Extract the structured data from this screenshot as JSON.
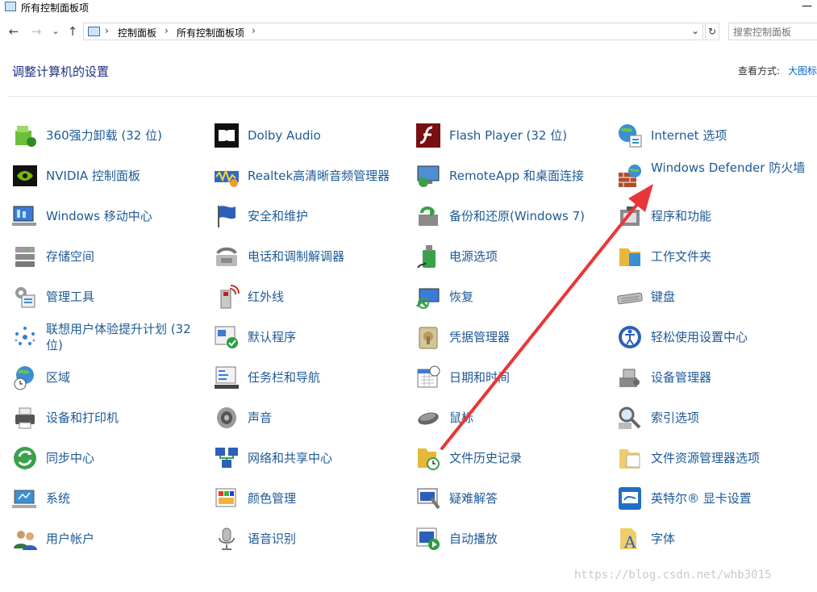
{
  "window": {
    "title": "所有控制面板项",
    "minimize_glyph": "—"
  },
  "nav": {
    "back_glyph": "←",
    "forward_glyph": "→",
    "recent_glyph": "⌄",
    "up_glyph": "↑"
  },
  "address": {
    "crumbs": [
      "控制面板",
      "所有控制面板项"
    ],
    "separator": "›",
    "dropdown_glyph": "⌄",
    "refresh_glyph": "↻"
  },
  "search": {
    "placeholder": "搜索控制面板"
  },
  "header": {
    "title": "调整计算机的设置",
    "view_by_label": "查看方式:",
    "view_by_value": "大图标"
  },
  "items": [
    {
      "label": "360强力卸载 (32 位)",
      "icon": "uninstall-icon"
    },
    {
      "label": "Dolby Audio",
      "icon": "dolby-icon"
    },
    {
      "label": "Flash Player (32 位)",
      "icon": "flash-icon"
    },
    {
      "label": "Internet 选项",
      "icon": "internet-options-icon"
    },
    {
      "label": "NVIDIA 控制面板",
      "icon": "nvidia-icon"
    },
    {
      "label": "Realtek高清晰音频管理器",
      "icon": "realtek-audio-icon"
    },
    {
      "label": "RemoteApp 和桌面连接",
      "icon": "remoteapp-icon"
    },
    {
      "label": "Windows Defender 防火墙",
      "icon": "firewall-icon"
    },
    {
      "label": "Windows 移动中心",
      "icon": "mobility-center-icon"
    },
    {
      "label": "安全和维护",
      "icon": "security-flag-icon"
    },
    {
      "label": "备份和还原(Windows 7)",
      "icon": "backup-icon"
    },
    {
      "label": "程序和功能",
      "icon": "programs-icon"
    },
    {
      "label": "存储空间",
      "icon": "storage-icon"
    },
    {
      "label": "电话和调制解调器",
      "icon": "phone-modem-icon"
    },
    {
      "label": "电源选项",
      "icon": "power-icon"
    },
    {
      "label": "工作文件夹",
      "icon": "work-folders-icon"
    },
    {
      "label": "管理工具",
      "icon": "admin-tools-icon"
    },
    {
      "label": "红外线",
      "icon": "infrared-icon"
    },
    {
      "label": "恢复",
      "icon": "recovery-icon"
    },
    {
      "label": "键盘",
      "icon": "keyboard-icon"
    },
    {
      "label": "联想用户体验提升计划 (32 位)",
      "icon": "lenovo-icon"
    },
    {
      "label": "默认程序",
      "icon": "default-programs-icon"
    },
    {
      "label": "凭据管理器",
      "icon": "credential-icon"
    },
    {
      "label": "轻松使用设置中心",
      "icon": "ease-of-access-icon"
    },
    {
      "label": "区域",
      "icon": "region-icon"
    },
    {
      "label": "任务栏和导航",
      "icon": "taskbar-icon"
    },
    {
      "label": "日期和时间",
      "icon": "calendar-icon"
    },
    {
      "label": "设备管理器",
      "icon": "device-manager-icon"
    },
    {
      "label": "设备和打印机",
      "icon": "printer-icon"
    },
    {
      "label": "声音",
      "icon": "speaker-icon"
    },
    {
      "label": "鼠标",
      "icon": "mouse-icon"
    },
    {
      "label": "索引选项",
      "icon": "index-icon"
    },
    {
      "label": "同步中心",
      "icon": "sync-icon"
    },
    {
      "label": "网络和共享中心",
      "icon": "network-icon"
    },
    {
      "label": "文件历史记录",
      "icon": "file-history-icon"
    },
    {
      "label": "文件资源管理器选项",
      "icon": "folder-options-icon"
    },
    {
      "label": "系统",
      "icon": "system-icon"
    },
    {
      "label": "颜色管理",
      "icon": "color-management-icon"
    },
    {
      "label": "疑难解答",
      "icon": "troubleshoot-icon"
    },
    {
      "label": "英特尔® 显卡设置",
      "icon": "intel-graphics-icon"
    },
    {
      "label": "用户帐户",
      "icon": "user-accounts-icon"
    },
    {
      "label": "语音识别",
      "icon": "microphone-icon"
    },
    {
      "label": "自动播放",
      "icon": "autoplay-icon"
    },
    {
      "label": "字体",
      "icon": "fonts-icon"
    }
  ],
  "annotation": {
    "color": "#e8373a"
  },
  "watermark": {
    "text": "https://blog.csdn.net/whb3015"
  },
  "colors": {
    "link": "#1e5a96",
    "heading": "#1e3287"
  }
}
